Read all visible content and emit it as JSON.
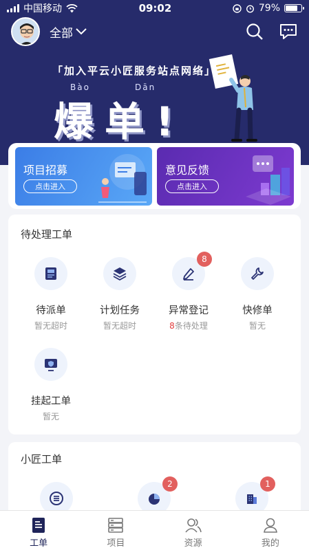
{
  "status_bar": {
    "carrier": "中国移动",
    "time": "09:02",
    "battery": "79%",
    "battery_level": 0.79
  },
  "header": {
    "scope_label": "全部"
  },
  "banner": {
    "slogan": "「加入平云小匠服务站点网络」",
    "pinyin_1": "Bào",
    "pinyin_2": "Dān",
    "headline": "爆单!"
  },
  "entry_cards": [
    {
      "title": "项目招募",
      "button": "点击进入"
    },
    {
      "title": "意见反馈",
      "button": "点击进入"
    }
  ],
  "pending": {
    "title": "待处理工单",
    "items": [
      {
        "label": "待派单",
        "sub": "暂无超时",
        "icon": "document-icon"
      },
      {
        "label": "计划任务",
        "sub": "暂无超时",
        "icon": "layers-icon"
      },
      {
        "label": "异常登记",
        "sub_count": "8",
        "sub_text": "条待处理",
        "badge": "8",
        "icon": "pen-icon"
      },
      {
        "label": "快修单",
        "sub": "暂无",
        "icon": "wrench-icon"
      },
      {
        "label": "挂起工单",
        "sub": "暂无",
        "icon": "monitor-shield-icon"
      }
    ]
  },
  "smith": {
    "title": "小匠工单",
    "items": [
      {
        "icon": "list-circle-icon"
      },
      {
        "icon": "pie-icon",
        "badge": "2"
      },
      {
        "icon": "building-icon",
        "badge": "1"
      }
    ]
  },
  "tabbar": {
    "tabs": [
      {
        "label": "工单",
        "active": true
      },
      {
        "label": "项目"
      },
      {
        "label": "资源"
      },
      {
        "label": "我的"
      }
    ]
  },
  "colors": {
    "hero": "#262b6b",
    "badge": "#e2605e",
    "accent_red": "#e23b3b"
  }
}
